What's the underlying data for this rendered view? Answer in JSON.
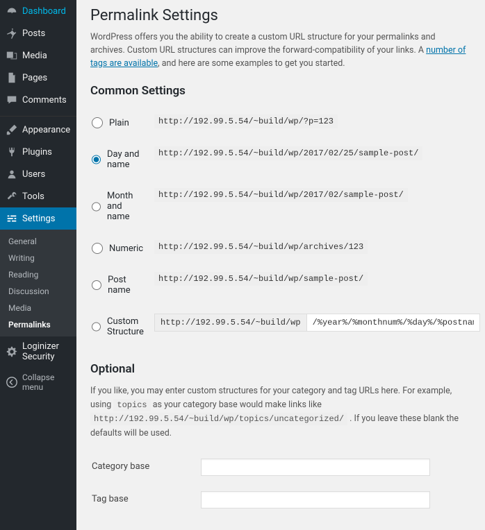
{
  "sidebar": {
    "items": [
      {
        "label": "Dashboard",
        "icon": "dashboard"
      },
      {
        "label": "Posts",
        "icon": "pin"
      },
      {
        "label": "Media",
        "icon": "media"
      },
      {
        "label": "Pages",
        "icon": "page"
      },
      {
        "label": "Comments",
        "icon": "comment"
      },
      {
        "label": "Appearance",
        "icon": "brush"
      },
      {
        "label": "Plugins",
        "icon": "plug"
      },
      {
        "label": "Users",
        "icon": "user"
      },
      {
        "label": "Tools",
        "icon": "wrench"
      },
      {
        "label": "Settings",
        "icon": "sliders"
      },
      {
        "label": "Loginizer Security",
        "icon": "gear"
      }
    ],
    "submenu": [
      {
        "label": "General"
      },
      {
        "label": "Writing"
      },
      {
        "label": "Reading"
      },
      {
        "label": "Discussion"
      },
      {
        "label": "Media"
      },
      {
        "label": "Permalinks"
      }
    ],
    "collapse": "Collapse menu"
  },
  "page": {
    "title": "Permalink Settings",
    "intro_pre": "WordPress offers you the ability to create a custom URL structure for your permalinks and archives. Custom URL structures can improve the forward-compatibility of your links. A ",
    "intro_link": "number of tags are available",
    "intro_post": ", and here are some examples to get you started.",
    "common_heading": "Common Settings",
    "options": [
      {
        "label": "Plain",
        "example": "http://192.99.5.54/~build/wp/?p=123",
        "checked": false
      },
      {
        "label": "Day and name",
        "example": "http://192.99.5.54/~build/wp/2017/02/25/sample-post/",
        "checked": true
      },
      {
        "label": "Month and name",
        "example": "http://192.99.5.54/~build/wp/2017/02/sample-post/",
        "checked": false
      },
      {
        "label": "Numeric",
        "example": "http://192.99.5.54/~build/wp/archives/123",
        "checked": false
      },
      {
        "label": "Post name",
        "example": "http://192.99.5.54/~build/wp/sample-post/",
        "checked": false
      }
    ],
    "custom": {
      "label": "Custom Structure",
      "prefix": "http://192.99.5.54/~build/wp",
      "value": "/%year%/%monthnum%/%day%/%postname%/"
    },
    "optional_heading": "Optional",
    "optional_desc_1": "If you like, you may enter custom structures for your category and tag URLs here. For example, using ",
    "optional_code_1": "topics",
    "optional_desc_2": " as your category base would make links like ",
    "optional_code_2": "http://192.99.5.54/~build/wp/topics/uncategorized/",
    "optional_desc_3": " . If you leave these blank the defaults will be used.",
    "category_base_label": "Category base",
    "category_base_value": "",
    "tag_base_label": "Tag base",
    "tag_base_value": ""
  }
}
